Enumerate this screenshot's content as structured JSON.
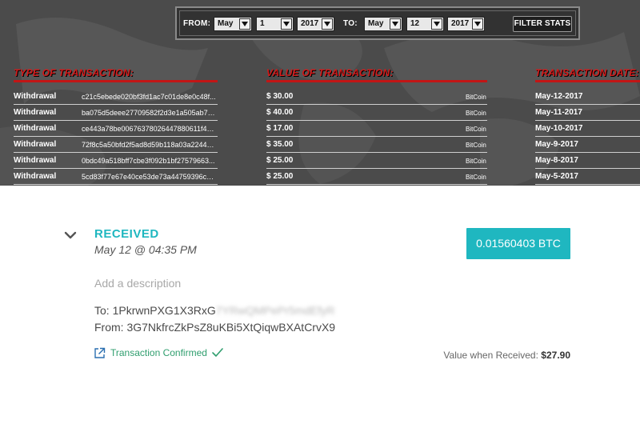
{
  "filter": {
    "from_label": "FROM:",
    "from_month": "May",
    "from_day": "1",
    "from_year": "2017",
    "to_label": "TO:",
    "to_month": "May",
    "to_day": "12",
    "to_year": "2017",
    "button_label": "FILTER STATS"
  },
  "table": {
    "headers": {
      "type": "TYPE OF TRANSACTION:",
      "value": "VALUE OF TRANSACTION:",
      "date": "TRANSACTION DATE:"
    },
    "rows": [
      {
        "type": "Withdrawal",
        "hash": "c21c5ebede020bf3fd1ac7c01de8e0c48f...",
        "value": "$ 30.00",
        "currency": "BitCoin",
        "date": "May-12-2017"
      },
      {
        "type": "Withdrawal",
        "hash": "ba075d5deee27709582f2d3e1a505ab772...",
        "value": "$ 40.00",
        "currency": "BitCoin",
        "date": "May-11-2017"
      },
      {
        "type": "Withdrawal",
        "hash": "ce443a78be00676378026447880611f4436...",
        "value": "$ 17.00",
        "currency": "BitCoin",
        "date": "May-10-2017"
      },
      {
        "type": "Withdrawal",
        "hash": "72f8c5a50bfd2f5ad8d59b118a03a2244c...",
        "value": "$ 35.00",
        "currency": "BitCoin",
        "date": "May-9-2017"
      },
      {
        "type": "Withdrawal",
        "hash": "0bdc49a518bff7cbe3f092b1bf27579663...",
        "value": "$ 25.00",
        "currency": "BitCoin",
        "date": "May-8-2017"
      },
      {
        "type": "Withdrawal",
        "hash": "5cd83f77e67e40ce53de73a44759396c21...",
        "value": "$ 25.00",
        "currency": "BitCoin",
        "date": "May-5-2017"
      }
    ]
  },
  "transaction": {
    "status": "RECEIVED",
    "datetime": "May 12 @ 04:35 PM",
    "amount": "0.01560403 BTC",
    "description_placeholder": "Add a description",
    "to_label": "To:",
    "to_address_visible": "1PkrwnPXG1X3RxG",
    "to_address_blurred": "7YRwQMPePr5mdEfyR",
    "from_label": "From:",
    "from_address": "3G7NkfrcZkPsZ8uKBi5XtQiqwBXAtCrvX9",
    "confirmed_label": "Transaction Confirmed",
    "value_when_received_label": "Value when Received:",
    "value_when_received": "$27.90"
  },
  "colors": {
    "accent_teal": "#1fb7c0",
    "header_red": "#c21515",
    "confirm_green": "#2f9e6e",
    "dark_bg": "#4b4b4b"
  },
  "icons": {
    "chevron": "chevron-down-icon",
    "external_link": "external-link-icon",
    "checkmark": "checkmark-icon",
    "select_arrow": "triangle-down-icon"
  }
}
